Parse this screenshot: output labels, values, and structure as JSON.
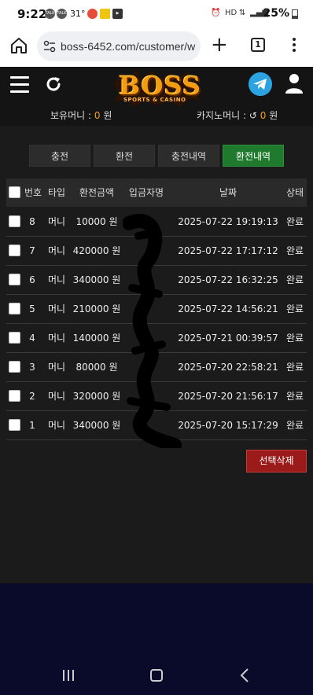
{
  "status_bar": {
    "time": "9:22",
    "temperature": "31°",
    "battery": "25%"
  },
  "browser": {
    "url": "boss-6452.com/customer/with",
    "tab_count": "1"
  },
  "header": {
    "logo_text": "BOSS",
    "logo_sub": "SPORTS & CASINO",
    "holding_money_label": "보유머니 :",
    "holding_money_value": "0",
    "casino_money_label": "카지노머니 :",
    "casino_money_value": "0",
    "currency": "원"
  },
  "tabs": [
    {
      "label": "충전",
      "active": false
    },
    {
      "label": "환전",
      "active": false
    },
    {
      "label": "충전내역",
      "active": false
    },
    {
      "label": "환전내역",
      "active": true
    }
  ],
  "table": {
    "headers": {
      "no": "번호",
      "type": "타입",
      "amount": "환전금액",
      "depositor": "입금자명",
      "date": "날짜",
      "status": "상태"
    },
    "rows": [
      {
        "no": "8",
        "type": "머니",
        "amount": "10000 원",
        "depositor": "",
        "date": "2025-07-22 19:19:13",
        "status": "완료"
      },
      {
        "no": "7",
        "type": "머니",
        "amount": "420000 원",
        "depositor": "",
        "date": "2025-07-22 17:17:12",
        "status": "완료"
      },
      {
        "no": "6",
        "type": "머니",
        "amount": "340000 원",
        "depositor": "",
        "date": "2025-07-22 16:32:25",
        "status": "완료"
      },
      {
        "no": "5",
        "type": "머니",
        "amount": "210000 원",
        "depositor": "",
        "date": "2025-07-22 14:56:21",
        "status": "완료"
      },
      {
        "no": "4",
        "type": "머니",
        "amount": "140000 원",
        "depositor": "",
        "date": "2025-07-21 00:39:57",
        "status": "완료"
      },
      {
        "no": "3",
        "type": "머니",
        "amount": "80000 원",
        "depositor": "",
        "date": "2025-07-20 22:58:21",
        "status": "완료"
      },
      {
        "no": "2",
        "type": "머니",
        "amount": "320000 원",
        "depositor": "",
        "date": "2025-07-20 21:56:17",
        "status": "완료"
      },
      {
        "no": "1",
        "type": "머니",
        "amount": "340000 원",
        "depositor": "",
        "date": "2025-07-20 15:17:29",
        "status": "완료"
      }
    ]
  },
  "delete_button": "선택삭제",
  "colors": {
    "accent_orange": "#f39c12",
    "active_tab": "#1f7a2e",
    "delete_red": "#9b1a1a",
    "telegram_blue": "#2aa3e0"
  }
}
